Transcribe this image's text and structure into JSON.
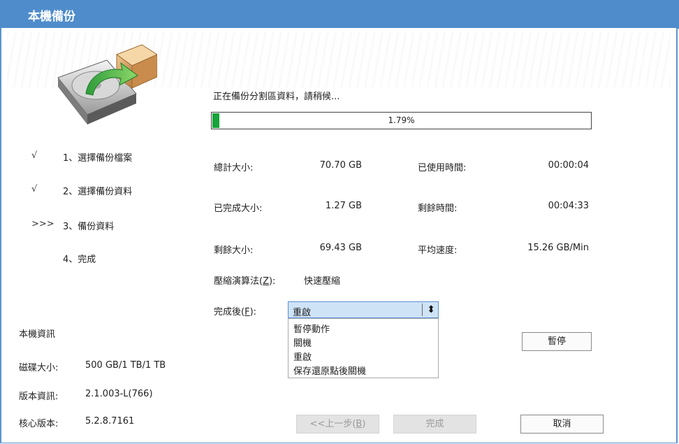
{
  "window": {
    "title": "本機備份"
  },
  "colors": {
    "accent": "#4f8ccc",
    "progress_fill": "#16a33a",
    "select_bg": "#cfe3f7"
  },
  "steps": [
    {
      "mark": "√",
      "label": "1、選擇備份檔案"
    },
    {
      "mark": "√",
      "label": "2、選擇備份資料"
    },
    {
      "mark": ">>>",
      "label": "3、備份資料"
    },
    {
      "mark": "",
      "label": "4、完成"
    }
  ],
  "machine_info": {
    "heading": "本機資訊",
    "disk_label": "磁碟大小:",
    "disk_value": "500 GB/1 TB/1 TB",
    "version_label": "版本資訊:",
    "version_value": "2.1.003-L(766)",
    "kernel_label": "核心版本:",
    "kernel_value": "5.2.8.7161"
  },
  "status_text": "正在備份分割區資料，請稍候...",
  "progress": {
    "percent": 1.79,
    "label": "1.79%"
  },
  "stats": {
    "total_label": "總計大小:",
    "total_value": "70.70 GB",
    "done_label": "已完成大小:",
    "done_value": "1.27 GB",
    "remain_label": "剩餘大小:",
    "remain_value": "69.43 GB",
    "elapsed_label": "已使用時間:",
    "elapsed_value": "00:00:04",
    "left_time_label": "剩餘時間:",
    "left_time_value": "00:04:33",
    "speed_label": "平均速度:",
    "speed_value": "15.26 GB/Min"
  },
  "compression": {
    "label_pre": "壓縮演算法(",
    "label_key": "Z",
    "label_post": "):",
    "value": "快速壓縮"
  },
  "after_done": {
    "label_pre": "完成後(",
    "label_key": "F",
    "label_post": "):",
    "selected": "重啟",
    "options": [
      "暫停動作",
      "關機",
      "重啟",
      "保存還原點後關機"
    ]
  },
  "buttons": {
    "pause": "暫停",
    "prev_pre": "<<上一步(",
    "prev_key": "B",
    "prev_post": ")",
    "finish": "完成",
    "cancel": "取消"
  }
}
